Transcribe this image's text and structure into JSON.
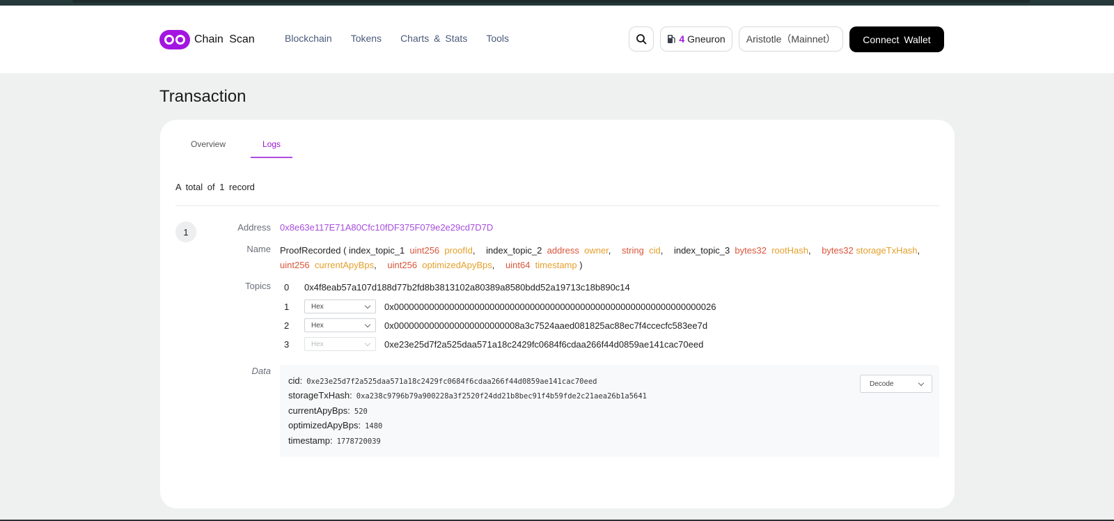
{
  "header": {
    "logo_text": "Chain Scan",
    "nav": [
      "Blockchain",
      "Tokens",
      "Charts & Stats",
      "Tools"
    ],
    "gas_value": "4",
    "gas_unit": "Gneuron",
    "network": "Aristotle（Mainnet）",
    "connect_label": "Connect Wallet"
  },
  "page": {
    "title": "Transaction",
    "tabs": {
      "overview": "Overview",
      "logs": "Logs"
    },
    "total_text": "A total of 1 record"
  },
  "log": {
    "index": "1",
    "labels": {
      "address": "Address",
      "name": "Name",
      "topics": "Topics",
      "data": "Data"
    },
    "address": "0x8e63e117E71A80Cfc10fDF375F079e2e29cd7D7D",
    "name": {
      "event": "ProofRecorded",
      "open": "(",
      "close": ")",
      "params": [
        {
          "prefix": "index_topic_1",
          "type": "uint256",
          "name": "proofId"
        },
        {
          "prefix": "index_topic_2",
          "type": "address",
          "name": "owner"
        },
        {
          "prefix": "",
          "type": "string",
          "name": "cid"
        },
        {
          "prefix": "index_topic_3",
          "type": "bytes32",
          "name": "rootHash"
        },
        {
          "prefix": "",
          "type": "bytes32",
          "name": "storageTxHash"
        },
        {
          "prefix": "",
          "type": "uint256",
          "name": "currentApyBps"
        },
        {
          "prefix": "",
          "type": "uint256",
          "name": "optimizedApyBps"
        },
        {
          "prefix": "",
          "type": "uint64",
          "name": "timestamp"
        }
      ]
    },
    "topics": [
      {
        "idx": "0",
        "value": "0x4f8eab57a107d188d77b2fd8b3813102a80389a8580bdd52a19713c18b890c14"
      },
      {
        "idx": "1",
        "format": "Hex",
        "value": "0x0000000000000000000000000000000000000000000000000000000000000026"
      },
      {
        "idx": "2",
        "format": "Hex",
        "value": "0x0000000000000000000000008a3c7524aaed081825ac88ec7f4ccecfc583ee7d"
      },
      {
        "idx": "3",
        "format": "Hex",
        "value": "0xe23e25d7f2a525daa571a18c2429fc0684f6cdaa266f44d0859ae141cac70eed"
      }
    ],
    "data": [
      {
        "key": "cid:",
        "value": "0xe23e25d7f2a525daa571a18c2429fc0684f6cdaa266f44d0859ae141cac70eed"
      },
      {
        "key": "storageTxHash:",
        "value": "0xa238c9796b79a900228a3f2520f24dd21b8bec91f4b59fde2c21aea26b1a5641"
      },
      {
        "key": "currentApyBps:",
        "value": "520"
      },
      {
        "key": "optimizedApyBps:",
        "value": "1480"
      },
      {
        "key": "timestamp:",
        "value": "1778720039"
      }
    ],
    "decode_label": "Decode"
  },
  "colors": {
    "accent": "#a315e0",
    "type_color": "#d9553a",
    "param_color": "#e4a02b",
    "address_color": "#a74ddc"
  }
}
